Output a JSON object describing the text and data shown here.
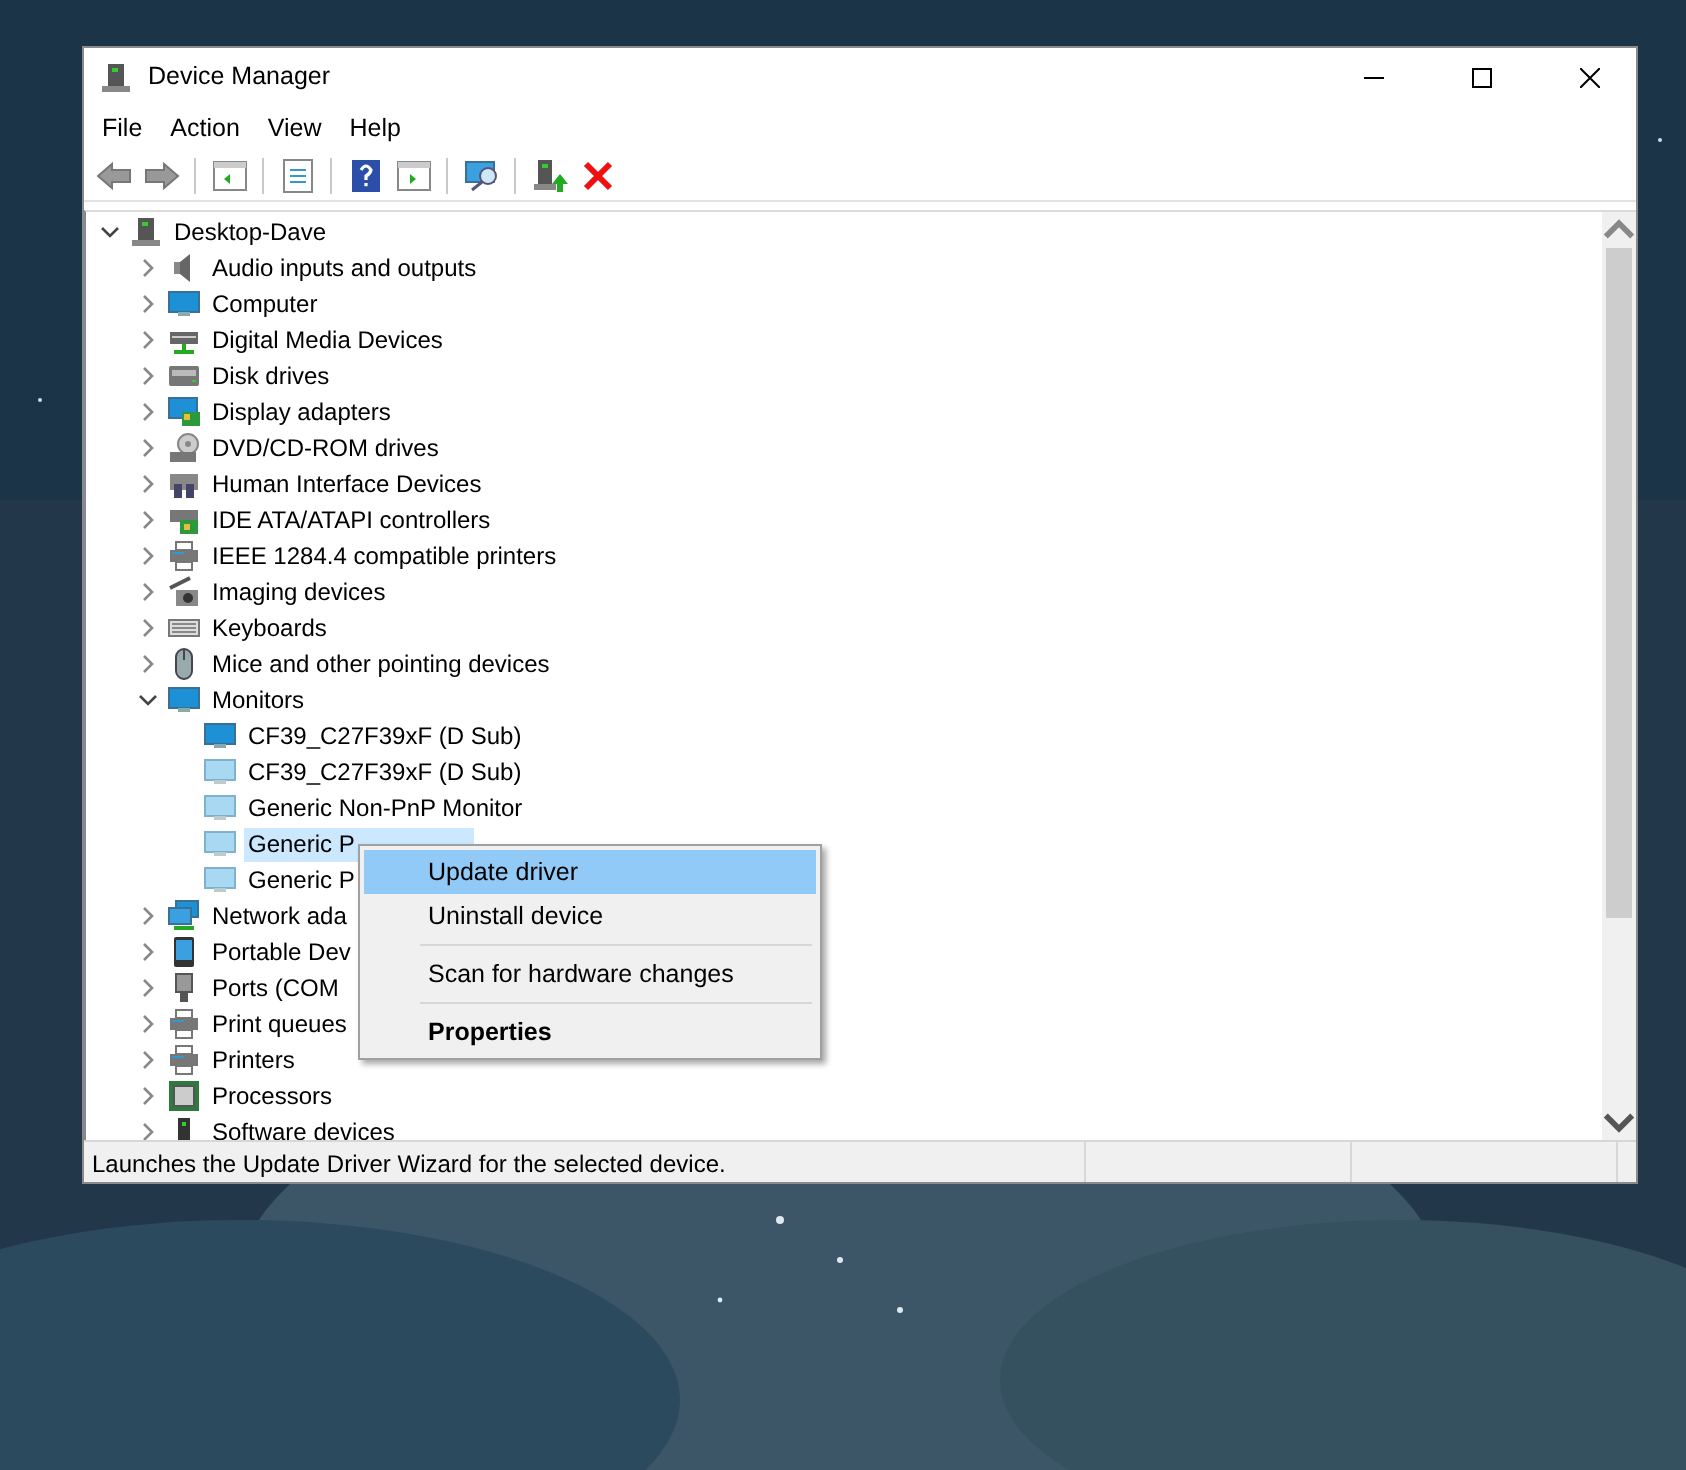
{
  "window": {
    "title": "Device Manager"
  },
  "menu": [
    "File",
    "Action",
    "View",
    "Help"
  ],
  "tree": {
    "label": "Desktop-Dave",
    "expanded": true,
    "children": [
      {
        "label": "Audio inputs and outputs",
        "expanded": false
      },
      {
        "label": "Computer",
        "expanded": false
      },
      {
        "label": "Digital Media Devices",
        "expanded": false
      },
      {
        "label": "Disk drives",
        "expanded": false
      },
      {
        "label": "Display adapters",
        "expanded": false
      },
      {
        "label": "DVD/CD-ROM drives",
        "expanded": false
      },
      {
        "label": "Human Interface Devices",
        "expanded": false
      },
      {
        "label": "IDE ATA/ATAPI controllers",
        "expanded": false
      },
      {
        "label": "IEEE 1284.4 compatible printers",
        "expanded": false
      },
      {
        "label": "Imaging devices",
        "expanded": false
      },
      {
        "label": "Keyboards",
        "expanded": false
      },
      {
        "label": "Mice and other pointing devices",
        "expanded": false
      },
      {
        "label": "Monitors",
        "expanded": true,
        "children": [
          {
            "label": "CF39_C27F39xF (D Sub)",
            "selected": false
          },
          {
            "label": "CF39_C27F39xF (D Sub)",
            "selected": false
          },
          {
            "label": "Generic Non-PnP Monitor",
            "selected": false
          },
          {
            "label": "Generic P",
            "selected": true
          },
          {
            "label": "Generic P",
            "selected": false
          }
        ]
      },
      {
        "label": "Network ada",
        "expanded": false
      },
      {
        "label": "Portable Dev",
        "expanded": false
      },
      {
        "label": "Ports (COM",
        "expanded": false
      },
      {
        "label": "Print queues",
        "expanded": false
      },
      {
        "label": "Printers",
        "expanded": false
      },
      {
        "label": "Processors",
        "expanded": false
      },
      {
        "label": "Software devices",
        "expanded": false
      }
    ]
  },
  "context_menu": [
    {
      "label": "Update driver",
      "selected": true,
      "separator_before": false,
      "default": false
    },
    {
      "label": "Uninstall device",
      "selected": false,
      "separator_before": false,
      "default": false
    },
    {
      "label": "Scan for hardware changes",
      "selected": false,
      "separator_before": true,
      "default": false
    },
    {
      "label": "Properties",
      "selected": false,
      "separator_before": true,
      "default": true
    }
  ],
  "status_bar": "Launches the Update Driver Wizard for the selected device."
}
